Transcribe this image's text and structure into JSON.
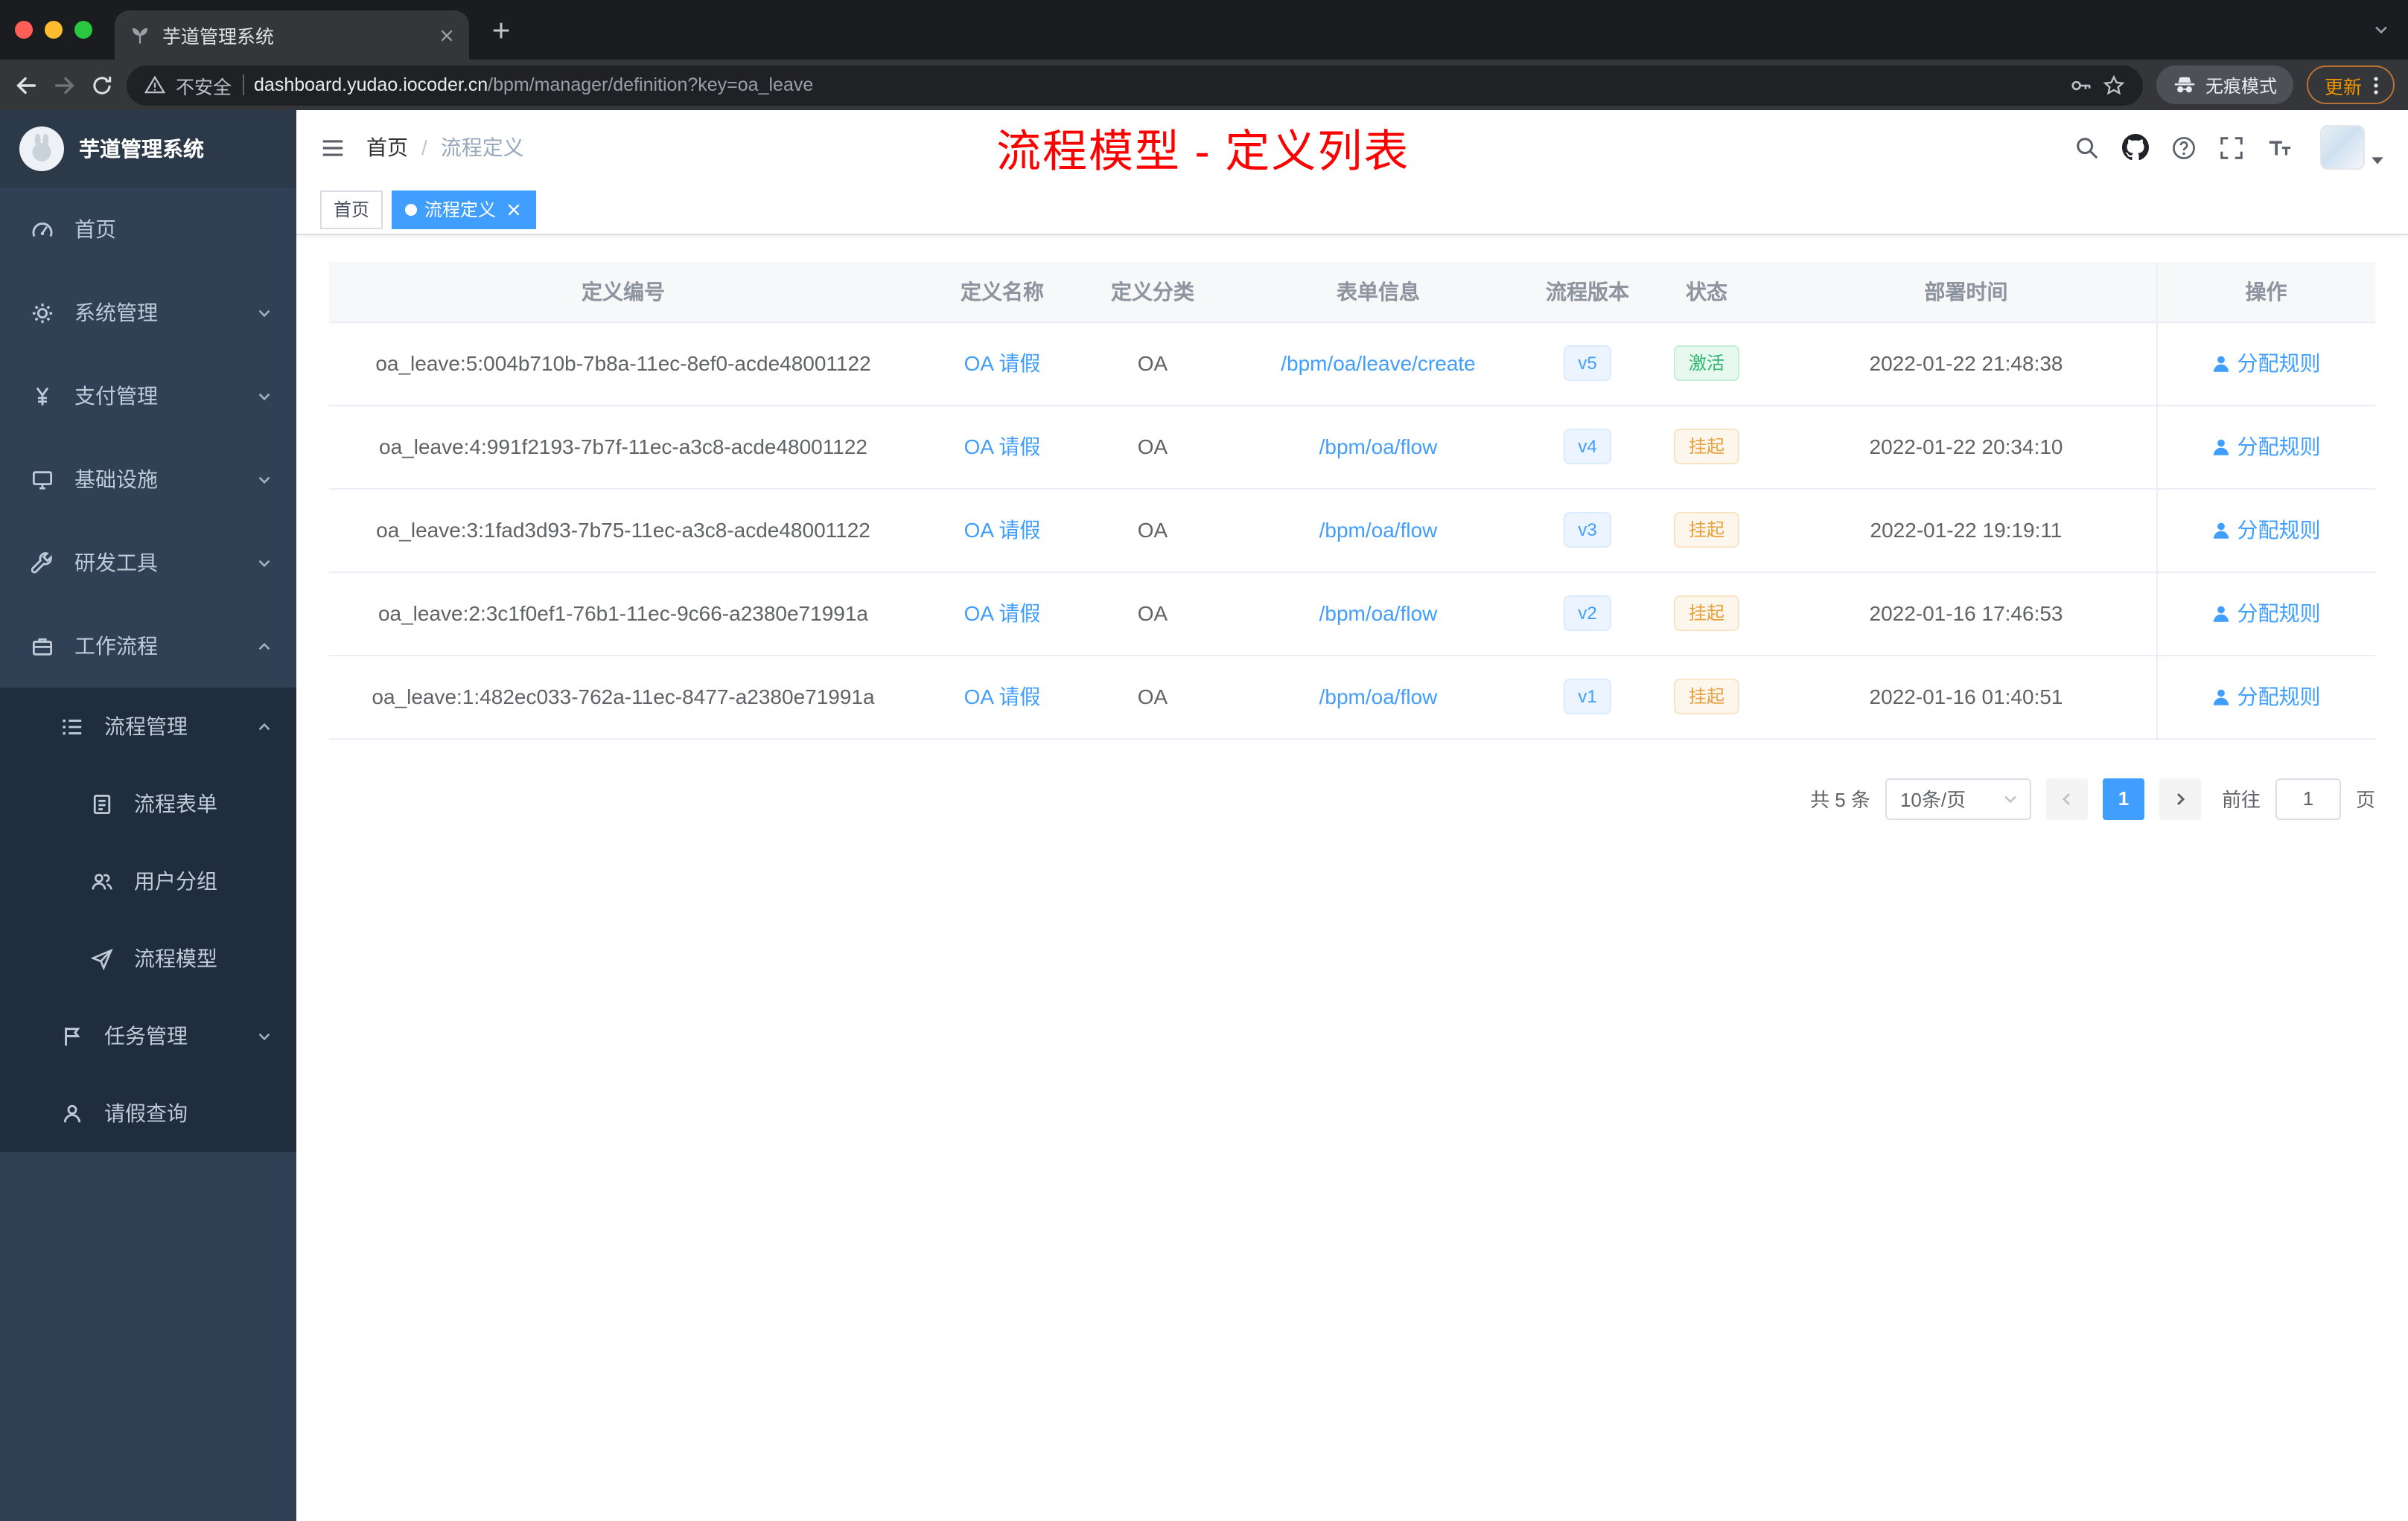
{
  "browser": {
    "tab_title": "芋道管理系统",
    "security_label": "不安全",
    "url_host": "dashboard.yudao.iocoder.cn",
    "url_path": "/bpm/manager/definition?key=oa_leave",
    "incognito_label": "无痕模式",
    "update_label": "更新"
  },
  "sidebar": {
    "logo_title": "芋道管理系统",
    "items": [
      {
        "name": "home",
        "label": "首页",
        "icon": "dashboard-icon",
        "level": 1,
        "expandable": false,
        "expanded": false
      },
      {
        "name": "system-management",
        "label": "系统管理",
        "icon": "gear-icon",
        "level": 1,
        "expandable": true,
        "expanded": false
      },
      {
        "name": "payment-management",
        "label": "支付管理",
        "icon": "yen-icon",
        "level": 1,
        "expandable": true,
        "expanded": false
      },
      {
        "name": "infrastructure",
        "label": "基础设施",
        "icon": "monitor-icon",
        "level": 1,
        "expandable": true,
        "expanded": false
      },
      {
        "name": "dev-tools",
        "label": "研发工具",
        "icon": "tools-icon",
        "level": 1,
        "expandable": true,
        "expanded": false
      },
      {
        "name": "workflow",
        "label": "工作流程",
        "icon": "workflow-icon",
        "level": 1,
        "expandable": true,
        "expanded": true
      },
      {
        "name": "process-management",
        "label": "流程管理",
        "icon": "process-list-icon",
        "level": 2,
        "expandable": true,
        "expanded": true
      },
      {
        "name": "process-form",
        "label": "流程表单",
        "icon": "form-icon",
        "level": 3,
        "expandable": false,
        "expanded": false
      },
      {
        "name": "user-group",
        "label": "用户分组",
        "icon": "user-group-icon",
        "level": 3,
        "expandable": false,
        "expanded": false
      },
      {
        "name": "process-model",
        "label": "流程模型",
        "icon": "paper-plane-icon",
        "level": 3,
        "expandable": false,
        "expanded": false
      },
      {
        "name": "task-management",
        "label": "任务管理",
        "icon": "task-icon",
        "level": 2,
        "expandable": true,
        "expanded": false
      },
      {
        "name": "leave-query",
        "label": "请假查询",
        "icon": "person-icon",
        "level": 2,
        "expandable": false,
        "expanded": false
      }
    ]
  },
  "header": {
    "breadcrumb": [
      "首页",
      "流程定义"
    ],
    "annotation": "流程模型 - 定义列表"
  },
  "tags": [
    {
      "label": "首页",
      "active": false,
      "closable": false
    },
    {
      "label": "流程定义",
      "active": true,
      "closable": true
    }
  ],
  "table": {
    "columns": [
      "定义编号",
      "定义名称",
      "定义分类",
      "表单信息",
      "流程版本",
      "状态",
      "部署时间",
      "操作"
    ],
    "rows": [
      {
        "id": "oa_leave:5:004b710b-7b8a-11ec-8ef0-acde48001122",
        "name": "OA 请假",
        "category": "OA",
        "form": "/bpm/oa/leave/create",
        "version": "v5",
        "status": "激活",
        "status_type": "success",
        "time": "2022-01-22 21:48:38",
        "action": "分配规则"
      },
      {
        "id": "oa_leave:4:991f2193-7b7f-11ec-a3c8-acde48001122",
        "name": "OA 请假",
        "category": "OA",
        "form": "/bpm/oa/flow",
        "version": "v4",
        "status": "挂起",
        "status_type": "warning",
        "time": "2022-01-22 20:34:10",
        "action": "分配规则"
      },
      {
        "id": "oa_leave:3:1fad3d93-7b75-11ec-a3c8-acde48001122",
        "name": "OA 请假",
        "category": "OA",
        "form": "/bpm/oa/flow",
        "version": "v3",
        "status": "挂起",
        "status_type": "warning",
        "time": "2022-01-22 19:19:11",
        "action": "分配规则"
      },
      {
        "id": "oa_leave:2:3c1f0ef1-76b1-11ec-9c66-a2380e71991a",
        "name": "OA 请假",
        "category": "OA",
        "form": "/bpm/oa/flow",
        "version": "v2",
        "status": "挂起",
        "status_type": "warning",
        "time": "2022-01-16 17:46:53",
        "action": "分配规则"
      },
      {
        "id": "oa_leave:1:482ec033-762a-11ec-8477-a2380e71991a",
        "name": "OA 请假",
        "category": "OA",
        "form": "/bpm/oa/flow",
        "version": "v1",
        "status": "挂起",
        "status_type": "warning",
        "time": "2022-01-16 01:40:51",
        "action": "分配规则"
      }
    ]
  },
  "pagination": {
    "total": "共 5 条",
    "page_size": "10条/页",
    "current_page": "1",
    "goto_label": "前往",
    "goto_value": "1",
    "page_unit": "页"
  },
  "colors": {
    "accent": "#409eff",
    "success": "#2db56f",
    "warning": "#e6a23c",
    "annotation": "#fe0000"
  }
}
